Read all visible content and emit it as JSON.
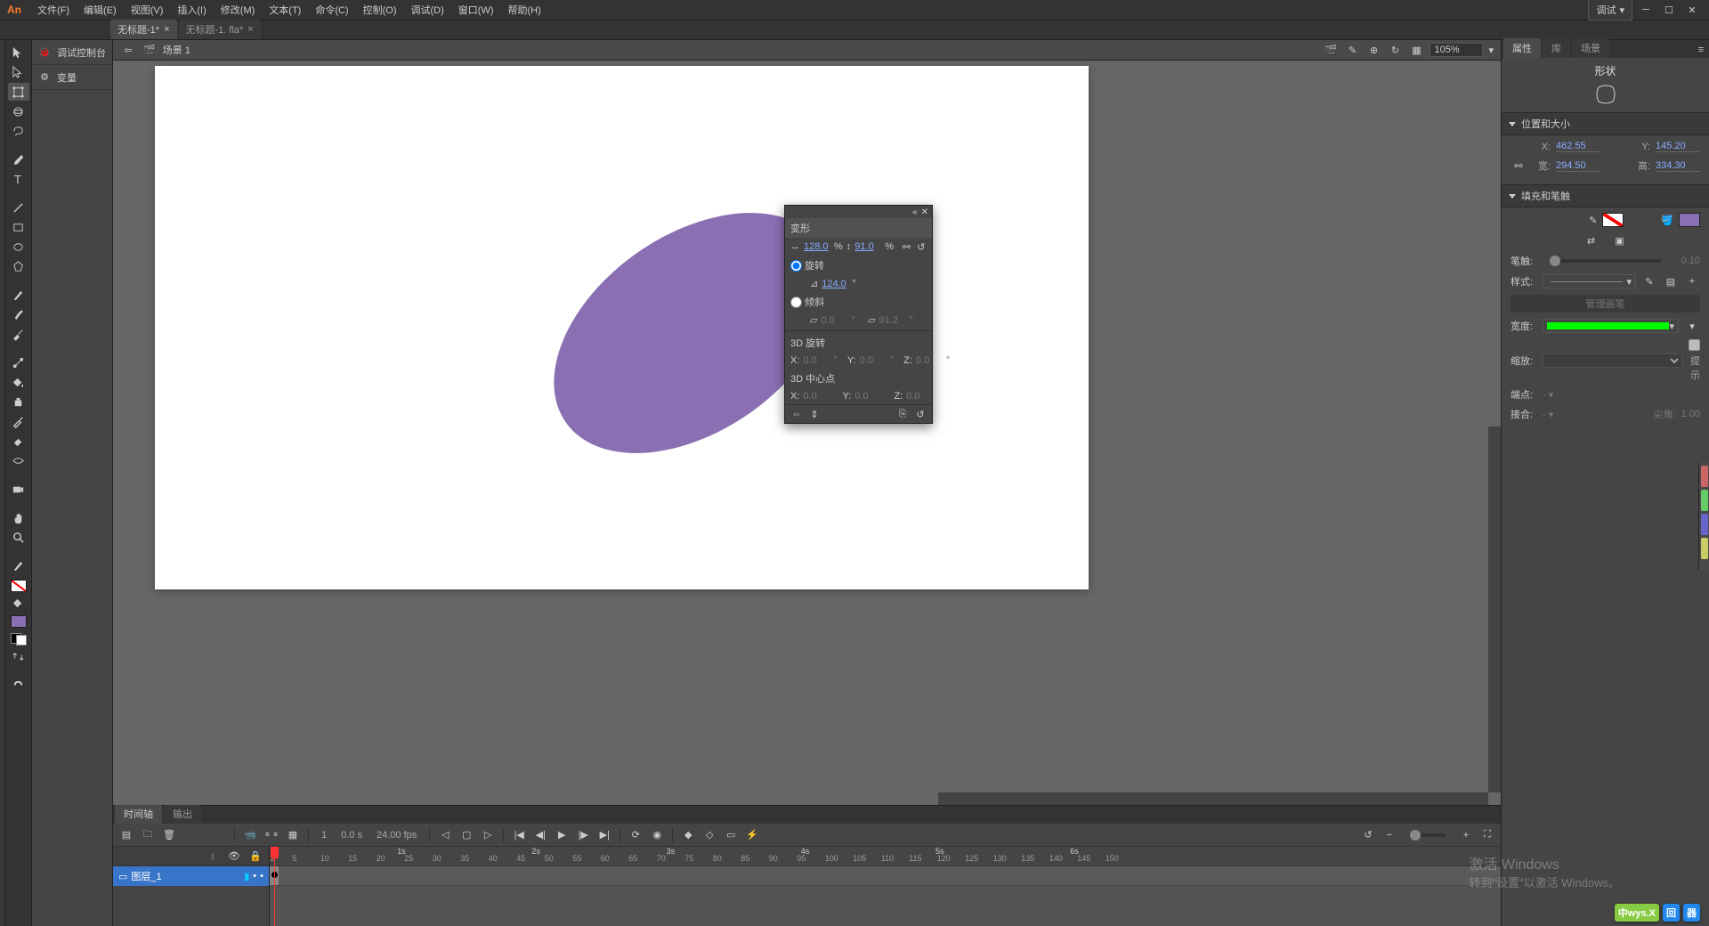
{
  "app": {
    "logo": "An"
  },
  "menu": {
    "file": "文件(F)",
    "edit": "编辑(E)",
    "view": "视图(V)",
    "insert": "插入(I)",
    "modify": "修改(M)",
    "text": "文本(T)",
    "command": "命令(C)",
    "control": "控制(O)",
    "debug": "调试(D)",
    "window": "窗口(W)",
    "help": "帮助(H)"
  },
  "workspace_preset": "调试",
  "doc_tabs": [
    {
      "label": "无标题-1*",
      "active": true
    },
    {
      "label": "无标题-1. fla*",
      "active": false
    }
  ],
  "left_panel": {
    "console": "调试控制台",
    "variables": "变量"
  },
  "scene": {
    "label": "场景 1",
    "zoom": "105%"
  },
  "transform_panel": {
    "title": "变形",
    "width_pct": "128.0",
    "height_pct": "91.0",
    "pct_suffix": "%",
    "rotate_label": "旋转",
    "rotate_val": "124.0",
    "skew_label": "倾斜",
    "skew_h": "0.0",
    "skew_v": "91.2",
    "deg_suffix": "°",
    "rot3d_label": "3D 旋转",
    "rot3d_x": "0.0",
    "rot3d_y": "0.0",
    "rot3d_z": "0.0",
    "center3d_label": "3D 中心点",
    "center3d_x": "0.0",
    "center3d_y": "0.0",
    "center3d_z": "0.0",
    "x_label": "X:",
    "y_label": "Y:",
    "z_label": "Z:"
  },
  "timeline": {
    "tab_timeline": "时间轴",
    "tab_output": "输出",
    "frame_no": "1",
    "time": "0.0 s",
    "fps": "24.00 fps",
    "layer_name": "图层_1",
    "ruler_major": [
      1,
      5,
      10,
      15,
      20,
      25,
      30,
      35,
      40,
      45,
      50,
      55,
      60,
      65,
      70,
      75,
      80,
      85,
      90,
      95,
      100,
      105,
      110,
      115,
      120,
      125,
      130,
      135,
      140,
      145,
      150
    ],
    "ruler_secs": [
      "1s",
      "2s",
      "3s",
      "4s",
      "5s",
      "6s"
    ]
  },
  "properties": {
    "tab_props": "属性",
    "tab_lib": "库",
    "tab_scene": "场景",
    "title": "形状",
    "grp_position": "位置和大小",
    "x_label": "X:",
    "x_val": "462.55",
    "y_label": "Y:",
    "y_val": "145.20",
    "w_label": "宽:",
    "w_val": "294.50",
    "h_label": "高:",
    "h_val": "334.30",
    "grp_fillstroke": "填充和笔触",
    "stroke_label": "笔触:",
    "stroke_val": "0.10",
    "style_label": "样式:",
    "manage_brush": "管理画笔",
    "width_label": "宽度:",
    "scale_label": "缩放:",
    "hint_label": "提示",
    "caps_label": "端点:",
    "join_label": "接合:",
    "miter_label": "尖角:",
    "miter_val": "1.00"
  },
  "watermark": {
    "title": "激活 Windows",
    "sub": "转到\"设置\"以激活 Windows。"
  },
  "branding": {
    "a": "中wys.X",
    "b": "回",
    "c": "器"
  }
}
